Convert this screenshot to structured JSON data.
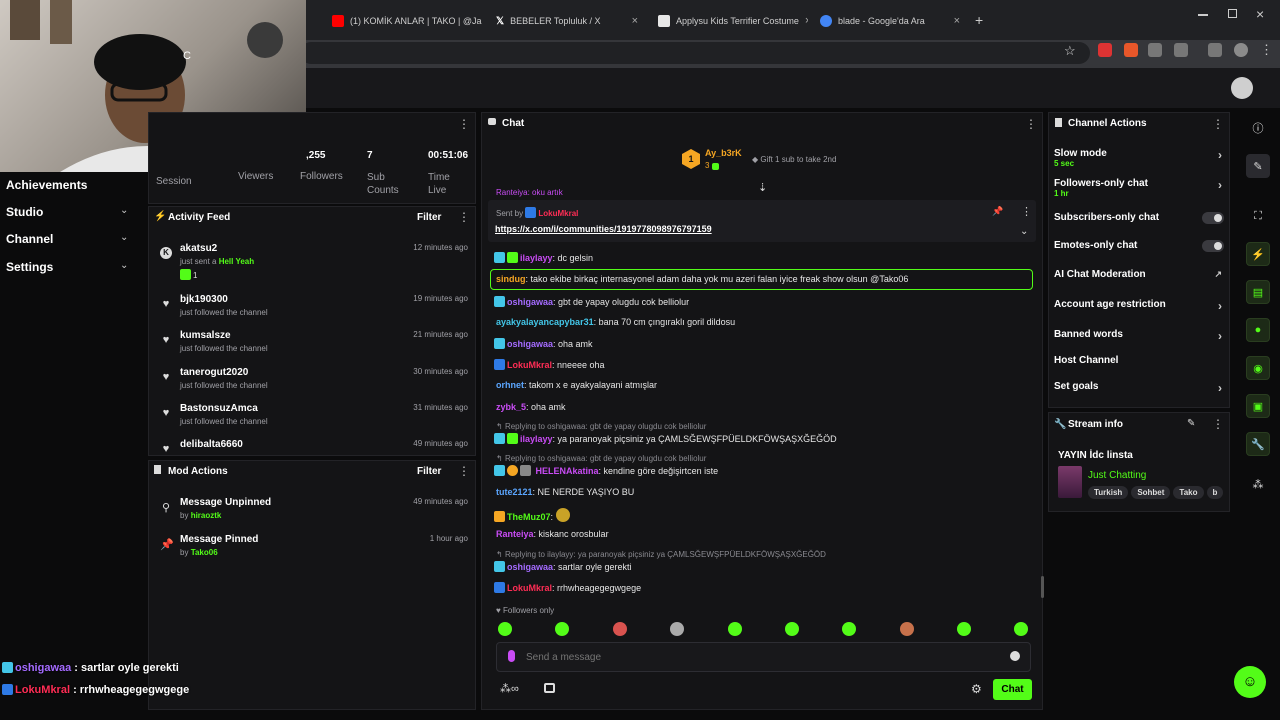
{
  "browser": {
    "tabs": [
      {
        "title": "(1) KOMİK ANLAR | TAKO | @Ja",
        "color": "#ff0000"
      },
      {
        "title": "BEBELER Topluluk / X",
        "color": "#ffffff"
      },
      {
        "title": "Applysu Kids Terrifier Costume",
        "color": "#e7e7e7"
      },
      {
        "title": "blade - Google'da Ara",
        "color": "#4285f4"
      }
    ],
    "new_tab": "+",
    "close": "×"
  },
  "webcam_letter": "C",
  "nav": {
    "items": [
      "Achievements",
      "Studio",
      "Channel",
      "Settings"
    ]
  },
  "stats": {
    "viewers_value": ",255",
    "followers_value": "7",
    "time_value": "00:51:06",
    "session_label": "Session",
    "viewers_label": "Viewers",
    "followers_label": "Followers",
    "sub_counts_label": "Sub Counts",
    "time_live_label": "Time Live"
  },
  "activity": {
    "title": "Activity Feed",
    "filter": "Filter",
    "items": [
      {
        "name": "akatsu2",
        "sub": "just sent a",
        "gift": "Hell Yeah",
        "count": "1",
        "time": "12 minutes ago"
      },
      {
        "name": "bjk190300",
        "sub": "just followed the channel",
        "time": "19 minutes ago"
      },
      {
        "name": "kumsalsze",
        "sub": "just followed the channel",
        "time": "21 minutes ago"
      },
      {
        "name": "tanerogut2020",
        "sub": "just followed the channel",
        "time": "30 minutes ago"
      },
      {
        "name": "BastonsuzAmca",
        "sub": "just followed the channel",
        "time": "31 minutes ago"
      },
      {
        "name": "delibalta6660",
        "time": "49 minutes ago"
      }
    ]
  },
  "mod": {
    "title": "Mod Actions",
    "filter": "Filter",
    "items": [
      {
        "action": "Message Unpinned",
        "by_label": "by",
        "by": "hiraoztk",
        "time": "49 minutes ago"
      },
      {
        "action": "Message Pinned",
        "by_label": "by",
        "by": "Tako06",
        "time": "1 hour ago"
      }
    ]
  },
  "chat": {
    "title": "Chat",
    "top_gifter": {
      "name": "Ay_b3rK",
      "rank": "1",
      "count": "3",
      "note": "Gift 1 sub to take 2nd"
    },
    "cut_line": "Ranteiya: oku artık",
    "pinned": {
      "sent_by": "Sent by",
      "user": "LokuMkral",
      "link": "https://x.com/i/communities/1919778098976797159"
    },
    "messages": [
      {
        "user": "ilaylayy",
        "color": "#c94cf5",
        "text": ": dc gelsin"
      },
      {
        "user": "sindug",
        "color": "#f5a623",
        "text": ": tako ekibe birkaç internasyonel adam daha yok mu azeri falan iyice freak show olsun @Tako06"
      },
      {
        "user": "oshigawaa",
        "color": "#a46bff",
        "text": ": gbt de yapay olugdu cok belliolur"
      },
      {
        "user": "ayakyalayancapybar31",
        "color": "#43c6e8",
        "text": ": bana 70 cm çıngıraklı goril dildosu"
      },
      {
        "user": "oshigawaa",
        "color": "#a46bff",
        "text": ": oha amk"
      },
      {
        "user": "LokuMkral",
        "color": "#ff2d55",
        "text": ": nneeee oha"
      },
      {
        "user": "orhnet",
        "color": "#5ba6ff",
        "text": ": takom x e ayakyalayani atmışlar"
      },
      {
        "user": "zybk_5",
        "color": "#c94cf5",
        "text": ": oha amk"
      },
      {
        "reply": "Replying to oshigawaa: gbt de yapay olugdu cok belliolur"
      },
      {
        "user": "ilaylayy",
        "color": "#c94cf5",
        "text": ": ya paranoyak piçsiniz ya ÇAMLSĞEWŞFPÜELDKFÖWŞAŞXĞEĞÖD"
      },
      {
        "reply": "Replying to oshigawaa: gbt de yapay olugdu cok belliolur"
      },
      {
        "user": "HELENAkatina",
        "color": "#c94cf5",
        "text": ": kendine göre değişirtcen iste"
      },
      {
        "user": "tute2121",
        "color": "#5ba6ff",
        "text": ": NE NERDE YAŞIYO BU"
      },
      {
        "user": "TheMuz07",
        "color": "#53fc18",
        "text": ":"
      },
      {
        "user": "Ranteiya",
        "color": "#c94cf5",
        "text": ": kiskanc orosbular"
      },
      {
        "reply": "Replying to ilaylayy: ya paranoyak piçsiniz ya ÇAMLSĞEWŞFPÜELDKFÖWŞAŞXĞEĞÖD"
      },
      {
        "user": "oshigawaa",
        "color": "#a46bff",
        "text": ": sartlar oyle gerekti"
      },
      {
        "user": "LokuMkral",
        "color": "#ff2d55",
        "text": ": rrhwheagegegwgege"
      }
    ],
    "followers_only": "Followers only",
    "placeholder": "Send a message",
    "send_label": "Chat"
  },
  "channel_actions": {
    "title": "Channel Actions",
    "slow_mode": "Slow mode",
    "slow_mode_val": "5 sec",
    "followers_only": "Followers-only chat",
    "followers_only_val": "1 hr",
    "subscribers_only": "Subscribers-only chat",
    "emotes_only": "Emotes-only chat",
    "ai_mod": "AI Chat Moderation",
    "account_age": "Account age restriction",
    "banned_words": "Banned words",
    "host_channel": "Host Channel",
    "set_goals": "Set goals"
  },
  "stream_info": {
    "title": "Stream info",
    "stream_title": "YAYIN İdc linsta",
    "category": "Just Chatting",
    "tags": [
      "Turkish",
      "Sohbet",
      "Tako",
      "b"
    ]
  },
  "overlay": [
    {
      "user": "oshigawaa",
      "color": "#a46bff",
      "text": " : sartlar oyle gerekti"
    },
    {
      "user": "LokuMkral",
      "color": "#ff2d55",
      "text": " : rrhwheagegegwgege"
    }
  ],
  "colors": {
    "accent": "#53fc18"
  }
}
